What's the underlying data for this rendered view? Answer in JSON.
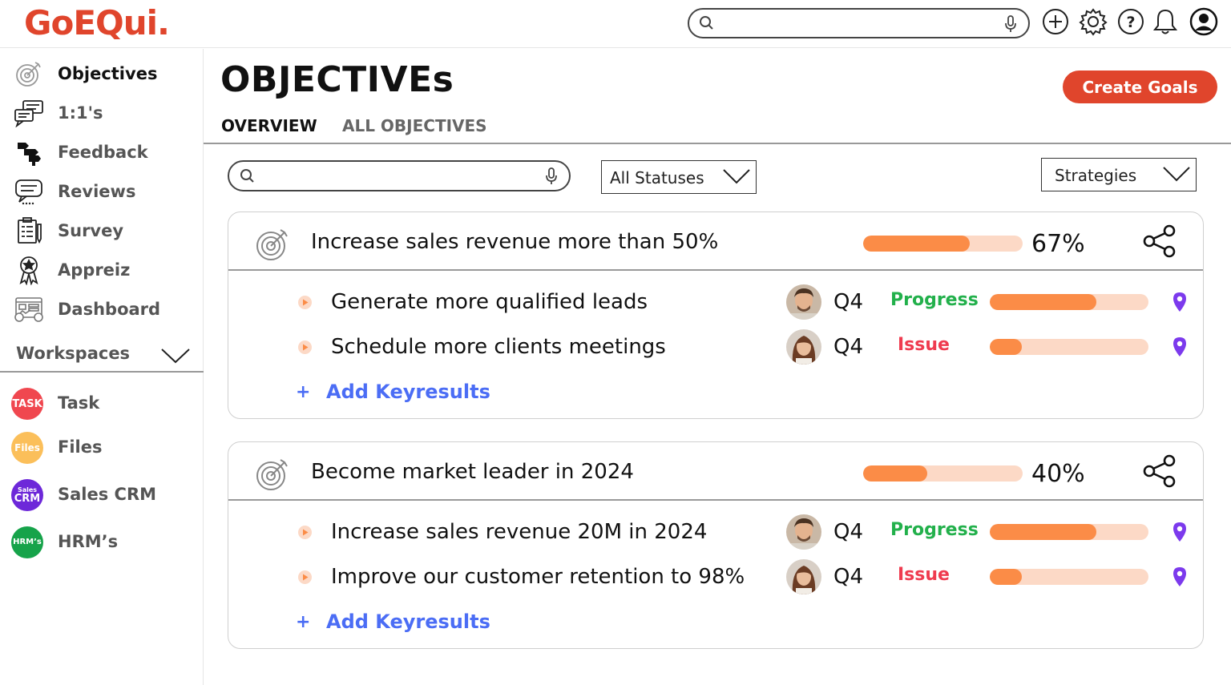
{
  "app": {
    "logo": "GoEQui."
  },
  "header": {
    "search_placeholder": "",
    "icons": [
      "add-icon",
      "settings-icon",
      "help-icon",
      "bell-icon",
      "user-icon"
    ]
  },
  "sidebar": {
    "items": [
      {
        "label": "Objectives",
        "icon": "target-icon",
        "active": true
      },
      {
        "label": "1:1's",
        "icon": "chat-icon"
      },
      {
        "label": "Feedback",
        "icon": "feedback-icon"
      },
      {
        "label": "Reviews",
        "icon": "reviews-icon"
      },
      {
        "label": "Survey",
        "icon": "survey-icon"
      },
      {
        "label": "Appreiz",
        "icon": "award-icon"
      },
      {
        "label": "Dashboard",
        "icon": "dashboard-icon"
      }
    ],
    "workspaces_label": "Workspaces",
    "workspaces": [
      {
        "label": "Task",
        "badge": "TASK",
        "color": "#f0474f"
      },
      {
        "label": "Files",
        "badge": "Files",
        "color": "#fbbf5a"
      },
      {
        "label": "Sales CRM",
        "badge_top": "Sales",
        "badge": "CRM",
        "color": "#6d28d9"
      },
      {
        "label": "HRM’s",
        "badge": "HRM’s",
        "color": "#16a34a"
      }
    ]
  },
  "main": {
    "title": "OBJECTIVEs",
    "create_button": "Create Goals",
    "tabs": [
      {
        "label": "OVERVIEW",
        "active": true
      },
      {
        "label": "ALL OBJECTIVES",
        "active": false
      }
    ],
    "filters": {
      "search_placeholder": "",
      "status_select": "All Statuses",
      "strategy_select": "Strategies"
    },
    "objectives": [
      {
        "title": "Increase sales revenue more than 50%",
        "progress": 0.67,
        "progress_label": "67%",
        "key_results": [
          {
            "title": "Generate more  qualified leads",
            "quarter": "Q4",
            "status": "Progress",
            "status_color": "#22b04b",
            "progress": 0.67,
            "avatar": "male"
          },
          {
            "title": "Schedule more clients meetings",
            "quarter": "Q4",
            "status": "Issue",
            "status_color": "#ef3b4f",
            "progress": 0.2,
            "avatar": "female"
          }
        ],
        "add_label": "Add Keyresults"
      },
      {
        "title": "Become market leader in 2024",
        "progress": 0.4,
        "progress_label": "40%",
        "key_results": [
          {
            "title": "Increase sales revenue 20M in 2024",
            "quarter": "Q4",
            "status": "Progress",
            "status_color": "#22b04b",
            "progress": 0.67,
            "avatar": "male"
          },
          {
            "title": "Improve our customer retention to 98%",
            "quarter": "Q4",
            "status": "Issue",
            "status_color": "#ef3b4f",
            "progress": 0.2,
            "avatar": "female"
          }
        ],
        "add_label": "Add Keyresults"
      }
    ]
  },
  "colors": {
    "brand": "#e0452c",
    "progress_fill": "#fb8c47",
    "progress_track": "#fcd9c6",
    "link": "#4b6df5",
    "pin": "#7c3aed"
  }
}
